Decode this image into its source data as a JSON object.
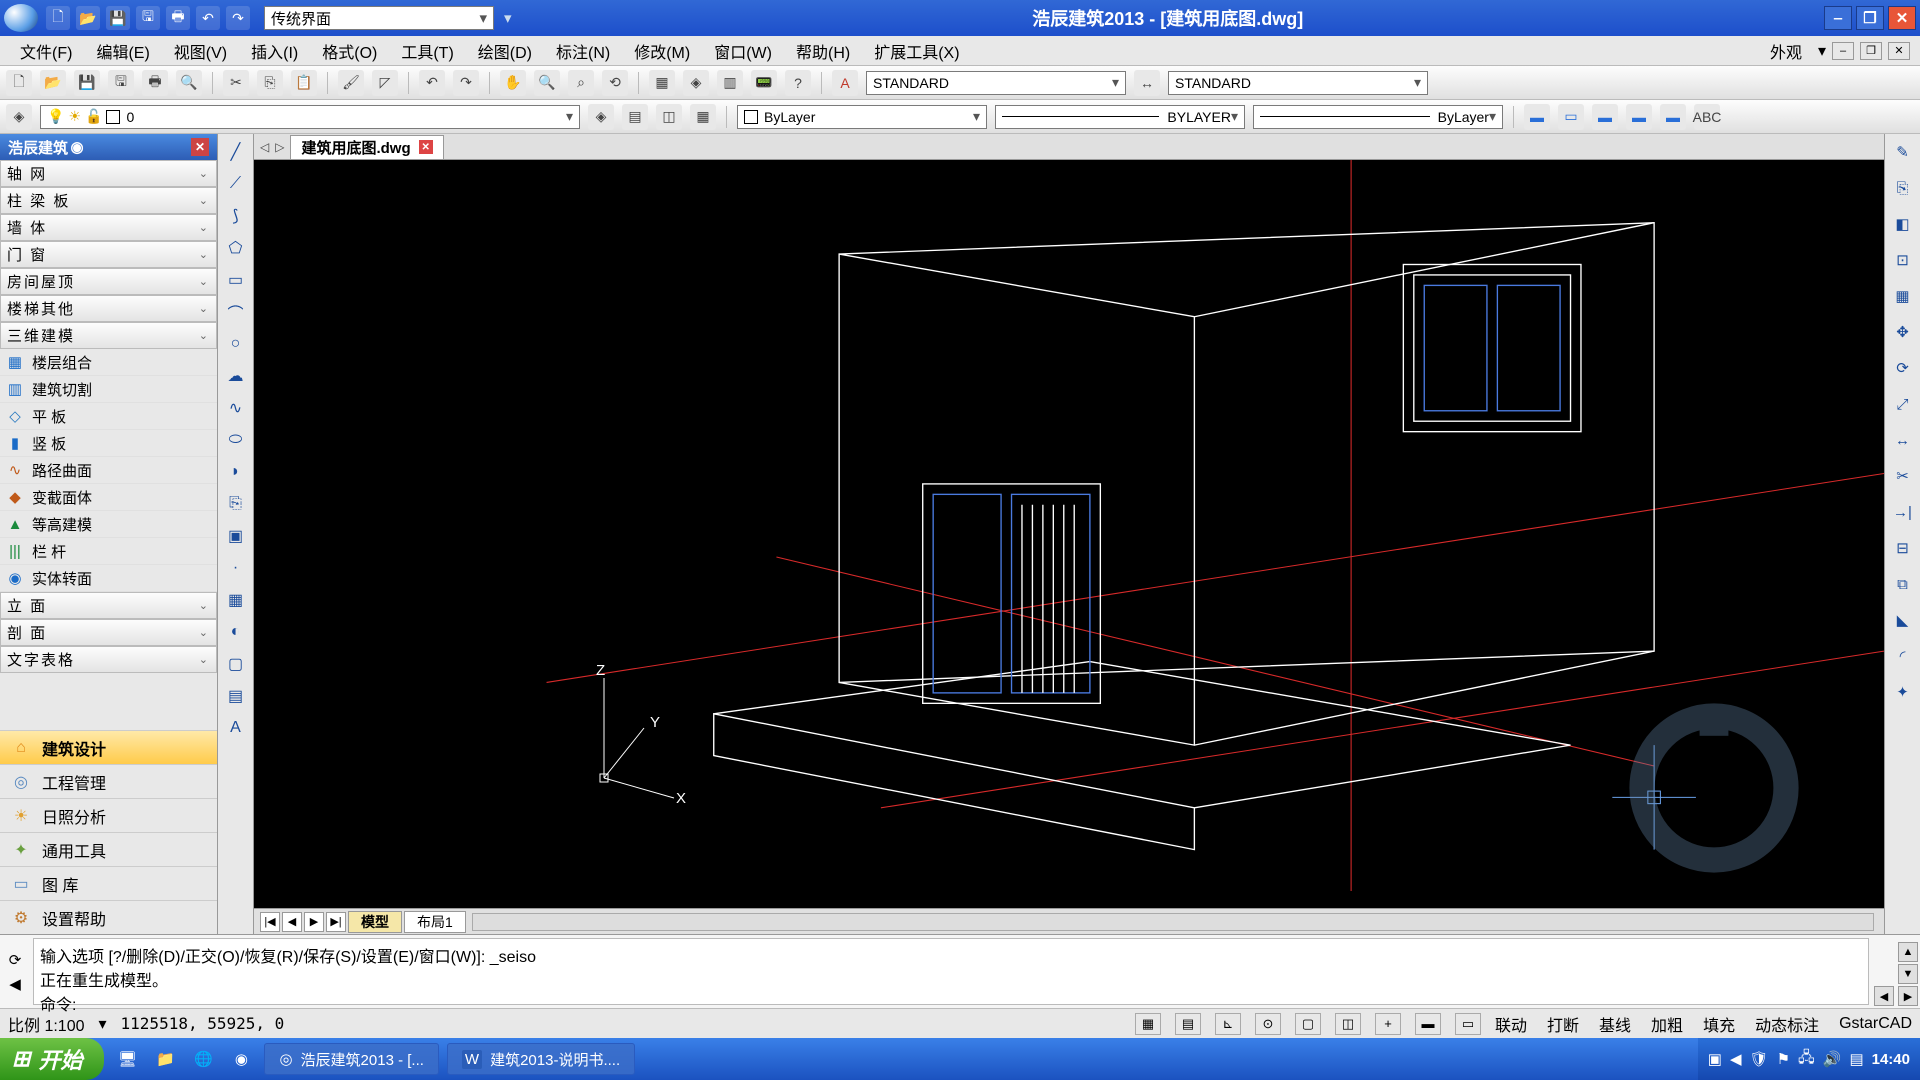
{
  "window": {
    "title": "浩辰建筑2013 - [建筑用底图.dwg]",
    "ui_mode": "传统界面"
  },
  "menubar": {
    "items": [
      "文件(F)",
      "编辑(E)",
      "视图(V)",
      "插入(I)",
      "格式(O)",
      "工具(T)",
      "绘图(D)",
      "标注(N)",
      "修改(M)",
      "窗口(W)",
      "帮助(H)",
      "扩展工具(X)"
    ],
    "right_label": "外观"
  },
  "toolbar": {
    "text_style": "STANDARD",
    "dim_style": "STANDARD",
    "layer": "0",
    "color": "ByLayer",
    "linetype": "BYLAYER",
    "lineweight": "ByLayer"
  },
  "palette": {
    "title": "浩辰建筑",
    "categories_top": [
      "轴    网",
      "柱 梁 板",
      "墙    体",
      "门    窗",
      "房间屋顶",
      "楼梯其他",
      "三维建模"
    ],
    "leaves": [
      {
        "icon": "▦",
        "label": "楼层组合",
        "color": "#1a6bc7"
      },
      {
        "icon": "▥",
        "label": "建筑切割",
        "color": "#1a6bc7"
      },
      {
        "icon": "◇",
        "label": "平    板",
        "color": "#2a7ac0"
      },
      {
        "icon": "▮",
        "label": "竖    板",
        "color": "#1a6bc7"
      },
      {
        "icon": "∿",
        "label": "路径曲面",
        "color": "#c05a1a"
      },
      {
        "icon": "◆",
        "label": "变截面体",
        "color": "#c05a1a"
      },
      {
        "icon": "▲",
        "label": "等高建模",
        "color": "#1a8a3c"
      },
      {
        "icon": "|||",
        "label": "栏    杆",
        "color": "#1a8a3c"
      },
      {
        "icon": "◉",
        "label": "实体转面",
        "color": "#1a6bc7"
      }
    ],
    "categories_bottom": [
      "立    面",
      "剖    面",
      "文字表格"
    ],
    "tabs": [
      {
        "icon": "⌂",
        "label": "建筑设计",
        "active": true,
        "color": "#e08a1a"
      },
      {
        "icon": "◎",
        "label": "工程管理",
        "active": false,
        "color": "#5a8ac0"
      },
      {
        "icon": "☀",
        "label": "日照分析",
        "active": false,
        "color": "#e0a030"
      },
      {
        "icon": "✦",
        "label": "通用工具",
        "active": false,
        "color": "#6aa040"
      },
      {
        "icon": "▭",
        "label": "图    库",
        "active": false,
        "color": "#5a8ac0"
      },
      {
        "icon": "⚙",
        "label": "设置帮助",
        "active": false,
        "color": "#c07a30"
      }
    ]
  },
  "document": {
    "filename": "建筑用底图.dwg",
    "layout_tabs": [
      "模型",
      "布局1"
    ]
  },
  "axis_labels": {
    "x": "X",
    "y": "Y",
    "z": "Z"
  },
  "command": {
    "line1": "输入选项 [?/删除(D)/正交(O)/恢复(R)/保存(S)/设置(E)/窗口(W)]: _seiso",
    "line2": "正在重生成模型。",
    "line3": "命令:"
  },
  "status": {
    "scale": "比例 1:100",
    "coords": "1125518, 55925, 0",
    "toggles": [
      "联动",
      "打断",
      "基线",
      "加粗",
      "填充",
      "动态标注"
    ],
    "brand": "GstarCAD"
  },
  "taskbar": {
    "start": "开始",
    "tasks": [
      "浩辰建筑2013 - [...",
      "建筑2013-说明书...."
    ],
    "clock": "14:40"
  }
}
